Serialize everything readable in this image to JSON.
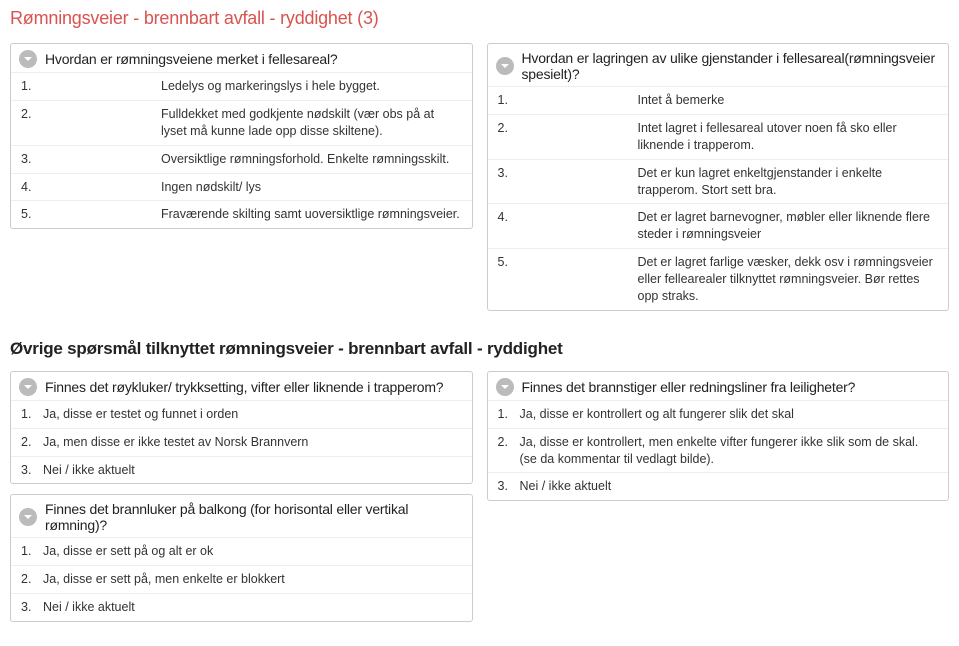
{
  "pageTitle": "Rømningsveier - brennbart avfall - ryddighet (3)",
  "q1": {
    "title": "Hvordan er rømningsveiene merket i fellesareal?",
    "items": [
      [
        "1.",
        "Ledelys og markeringslys i hele bygget."
      ],
      [
        "2.",
        "Fulldekket med godkjente nødskilt (vær obs på at lyset må kunne lade opp disse skiltene)."
      ],
      [
        "3.",
        "Oversiktlige rømningsforhold. Enkelte rømningsskilt."
      ],
      [
        "4.",
        "Ingen nødskilt/ lys"
      ],
      [
        "5.",
        "Fraværende skilting samt uoversiktlige rømningsveier."
      ]
    ]
  },
  "q2": {
    "title": "Hvordan er lagringen av ulike gjenstander i fellesareal(rømningsveier spesielt)?",
    "items": [
      [
        "1.",
        "Intet å bemerke"
      ],
      [
        "2.",
        "Intet lagret i fellesareal utover noen få sko eller liknende i trapperom."
      ],
      [
        "3.",
        "Det er kun lagret enkeltgjenstander i enkelte trapperom. Stort sett bra."
      ],
      [
        "4.",
        "Det er lagret barnevogner, møbler eller liknende flere steder i rømningsveier"
      ],
      [
        "5.",
        "Det er lagret farlige væsker, dekk osv i rømningsveier eller fellearealer tilknyttet rømningsveier. Bør rettes opp straks."
      ]
    ]
  },
  "sectionHeading": "Øvrige spørsmål tilknyttet rømningsveier - brennbart avfall - ryddighet",
  "q3": {
    "title": "Finnes det røykluker/ trykksetting, vifter eller liknende i trapperom?",
    "items": [
      [
        "1.",
        "Ja, disse er testet og funnet i orden"
      ],
      [
        "2.",
        "Ja, men disse er ikke testet av Norsk Brannvern"
      ],
      [
        "3.",
        "Nei / ikke aktuelt"
      ]
    ]
  },
  "q4": {
    "title": "Finnes det brannstiger eller redningsliner fra leiligheter?",
    "items": [
      [
        "1.",
        "Ja, disse er kontrollert og alt fungerer slik det skal"
      ],
      [
        "2.",
        "Ja, disse er kontrollert, men enkelte vifter fungerer ikke slik som de skal. (se da kommentar til vedlagt bilde)."
      ],
      [
        "3.",
        "Nei / ikke aktuelt"
      ]
    ]
  },
  "q5": {
    "title": "Finnes det brannluker på balkong (for horisontal eller vertikal rømning)?",
    "items": [
      [
        "1.",
        "Ja, disse er sett på og alt er ok"
      ],
      [
        "2.",
        "Ja, disse er sett på, men enkelte er blokkert"
      ],
      [
        "3.",
        "Nei / ikke aktuelt"
      ]
    ]
  }
}
